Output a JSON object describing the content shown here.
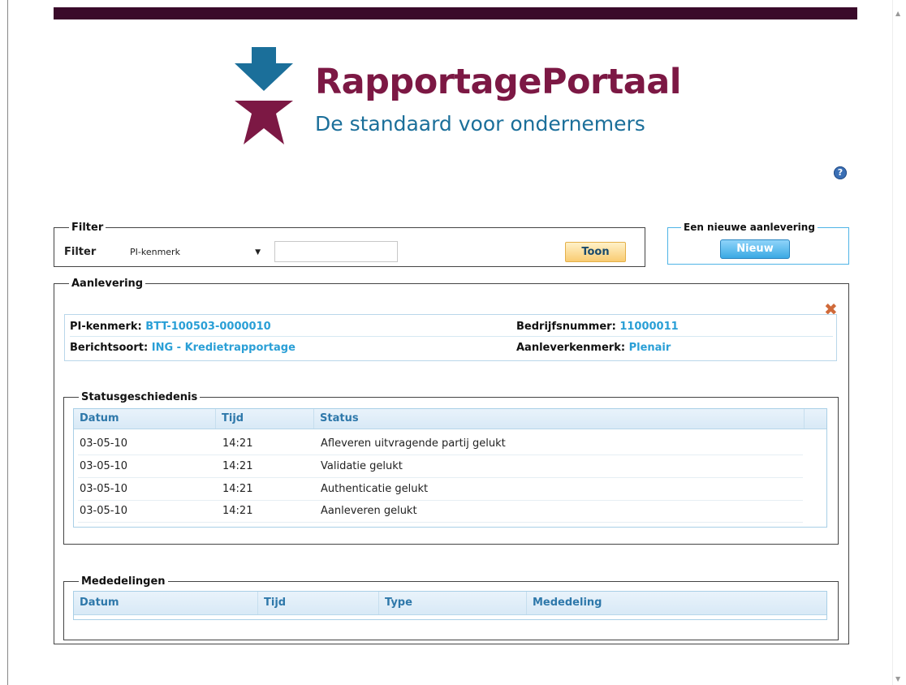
{
  "logo": {
    "title": "RapportagePortaal",
    "subtitle": "De standaard voor ondernemers"
  },
  "help": {
    "icon": "help-icon",
    "glyph": "?"
  },
  "filter": {
    "legend": "Filter",
    "label": "Filter",
    "select_value": "PI-kenmerk",
    "input_value": "",
    "button_label": "Toon"
  },
  "new_delivery": {
    "legend": "Een nieuwe aanlevering",
    "button_label": "Nieuw"
  },
  "delivery": {
    "legend": "Aanlevering",
    "close_icon": "close-icon",
    "pi_label": "PI-kenmerk:",
    "pi_value": "BTT-100503-0000010",
    "company_label": "Bedrijfsnummer:",
    "company_value": "11000011",
    "msgtype_label": "Berichtsoort:",
    "msgtype_value": "ING - Kredietrapportage",
    "ref_label": "Aanleverkenmerk:",
    "ref_value": "Plenair"
  },
  "status_history": {
    "legend": "Statusgeschiedenis",
    "columns": [
      "Datum",
      "Tijd",
      "Status"
    ],
    "rows": [
      [
        "03-05-10",
        "14:21",
        "Afleveren uitvragende partij gelukt"
      ],
      [
        "03-05-10",
        "14:21",
        "Validatie gelukt"
      ],
      [
        "03-05-10",
        "14:21",
        "Authenticatie gelukt"
      ],
      [
        "03-05-10",
        "14:21",
        "Aanleveren gelukt"
      ]
    ]
  },
  "notifications": {
    "legend": "Mededelingen",
    "columns": [
      "Datum",
      "Tijd",
      "Type",
      "Mededeling"
    ]
  },
  "colors": {
    "brand_purple": "#7c1844",
    "brand_blue": "#1b6f9a",
    "link_blue": "#2a9fd6",
    "header_bar": "#3a0a2a"
  }
}
